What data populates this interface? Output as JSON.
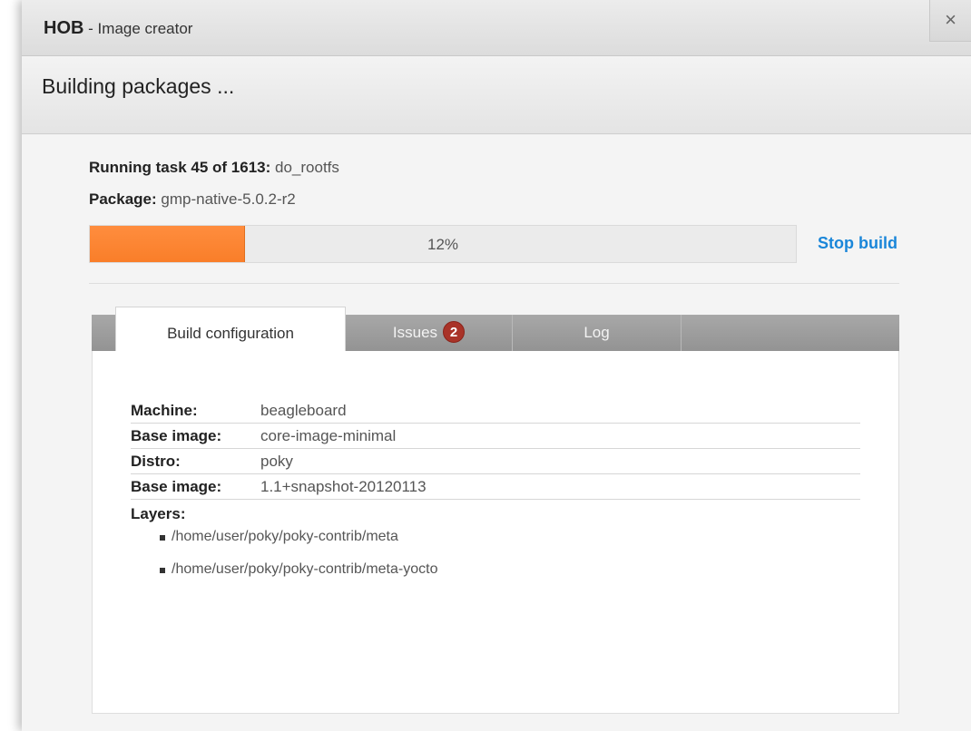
{
  "window": {
    "app_name": "HOB",
    "app_subtitle": " - Image creator",
    "close_label": "×"
  },
  "header": {
    "title": "Building packages ..."
  },
  "status": {
    "task_label": "Running task 45 of 1613:",
    "task_value": " do_rootfs",
    "package_label": "Package:",
    "package_value": " gmp-native-5.0.2-r2"
  },
  "progress": {
    "percent": 12,
    "text": "12%"
  },
  "stop_button": {
    "label": "Stop build"
  },
  "tabs": [
    {
      "label": "Build configuration",
      "active": true
    },
    {
      "label": "Issues",
      "badge": "2",
      "active": false
    },
    {
      "label": "Log",
      "active": false
    }
  ],
  "config": {
    "rows": [
      {
        "key": "Machine:",
        "value": "beagleboard"
      },
      {
        "key": "Base image:",
        "value": "core-image-minimal"
      },
      {
        "key": "Distro:",
        "value": "poky"
      },
      {
        "key": "Base image:",
        "value": "1.1+snapshot-20120113"
      }
    ],
    "layers_label": "Layers:",
    "layers": [
      "/home/user/poky/poky-contrib/meta",
      "/home/user/poky/poky-contrib/meta-yocto"
    ]
  },
  "colors": {
    "accent_orange": "#f97e29",
    "link_blue": "#1a86d9",
    "badge_red": "#a93328"
  }
}
